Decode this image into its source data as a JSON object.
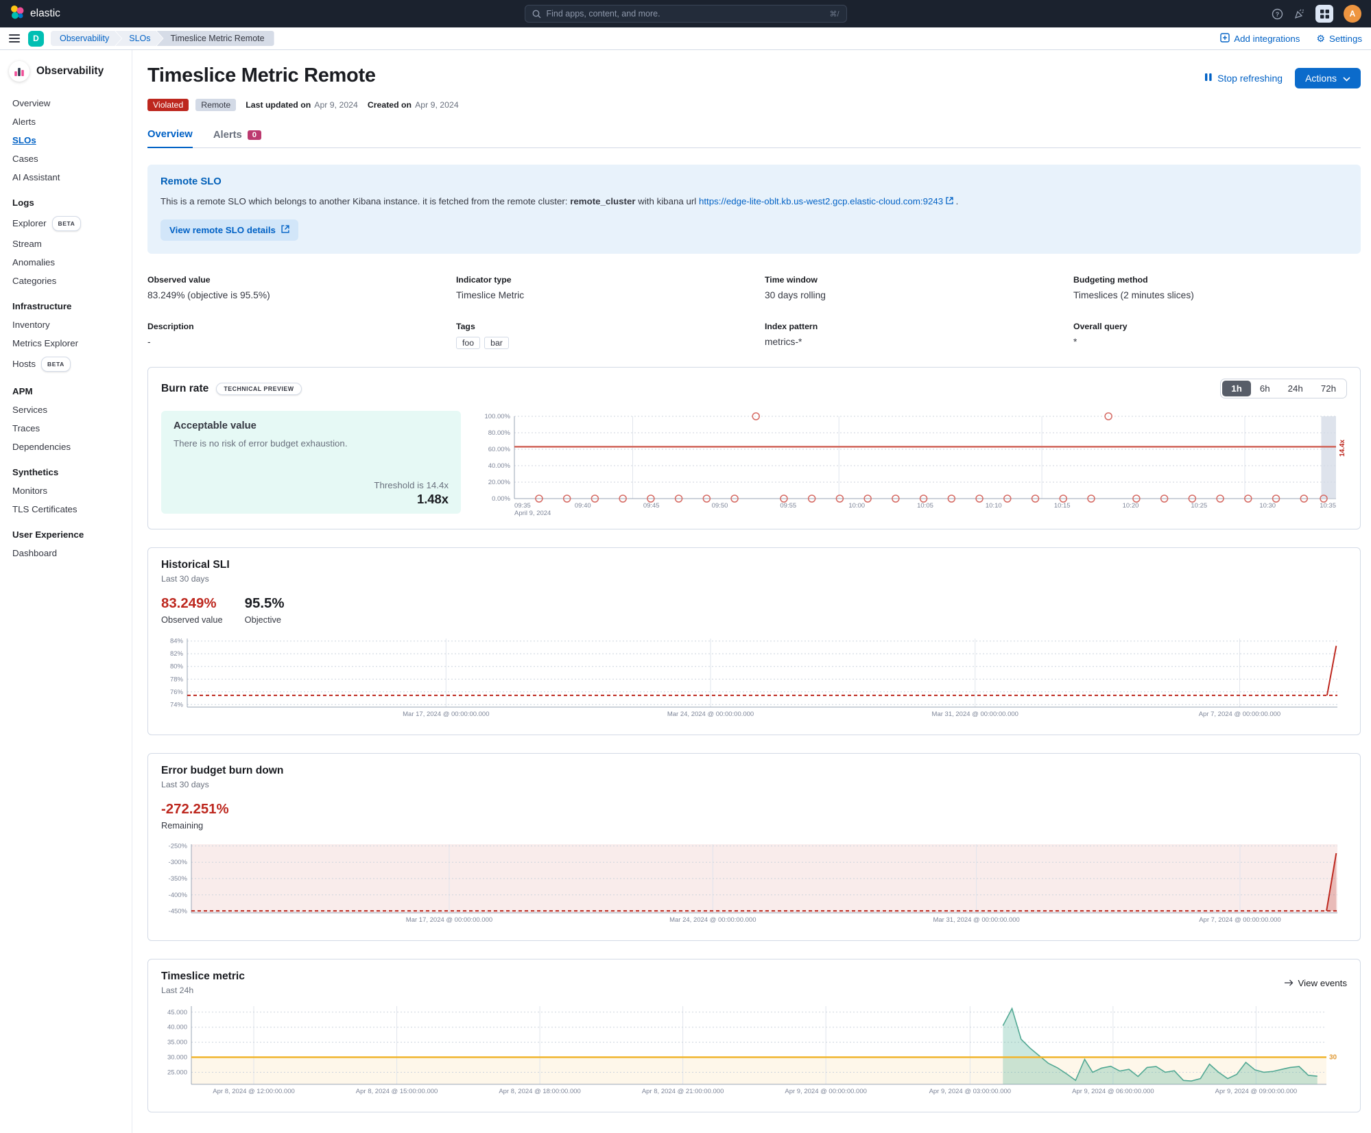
{
  "header": {
    "logo_text": "elastic",
    "search_placeholder": "Find apps, content, and more.",
    "search_shortcut": "⌘/",
    "avatar_initial": "A"
  },
  "nav": {
    "space_initial": "D",
    "breadcrumbs": [
      {
        "label": "Observability",
        "type": "link"
      },
      {
        "label": "SLOs",
        "type": "link"
      },
      {
        "label": "Timeslice Metric Remote",
        "type": "current"
      }
    ],
    "add_integrations": "Add integrations",
    "settings": "Settings"
  },
  "sidebar": {
    "app_title": "Observability",
    "sections": [
      {
        "title": null,
        "items": [
          {
            "label": "Overview"
          },
          {
            "label": "Alerts"
          },
          {
            "label": "SLOs",
            "active": true
          },
          {
            "label": "Cases"
          },
          {
            "label": "AI Assistant"
          }
        ]
      },
      {
        "title": "Logs",
        "items": [
          {
            "label": "Explorer",
            "badge": "BETA"
          },
          {
            "label": "Stream"
          },
          {
            "label": "Anomalies"
          },
          {
            "label": "Categories"
          }
        ]
      },
      {
        "title": "Infrastructure",
        "items": [
          {
            "label": "Inventory"
          },
          {
            "label": "Metrics Explorer"
          },
          {
            "label": "Hosts",
            "badge": "BETA"
          }
        ]
      },
      {
        "title": "APM",
        "items": [
          {
            "label": "Services"
          },
          {
            "label": "Traces"
          },
          {
            "label": "Dependencies"
          }
        ]
      },
      {
        "title": "Synthetics",
        "items": [
          {
            "label": "Monitors"
          },
          {
            "label": "TLS Certificates"
          }
        ]
      },
      {
        "title": "User Experience",
        "items": [
          {
            "label": "Dashboard"
          }
        ]
      }
    ]
  },
  "page": {
    "title": "Timeslice Metric Remote",
    "status_badge": "Violated",
    "remote_badge": "Remote",
    "last_updated_label": "Last updated on",
    "last_updated_value": "Apr 9, 2024",
    "created_label": "Created on",
    "created_value": "Apr 9, 2024",
    "stop_refreshing": "Stop refreshing",
    "actions": "Actions"
  },
  "tabs": [
    {
      "label": "Overview",
      "active": true
    },
    {
      "label": "Alerts",
      "badge": "0"
    }
  ],
  "callout": {
    "title": "Remote SLO",
    "text_before": "This is a remote SLO which belongs to another Kibana instance. it is fetched from the remote cluster:",
    "cluster": "remote_cluster",
    "text_middle": "with kibana url",
    "url": "https://edge-lite-oblt.kb.us-west2.gcp.elastic-cloud.com:9243",
    "text_after": ".",
    "button": "View remote SLO details"
  },
  "definition": {
    "rows": [
      [
        {
          "label": "Observed value",
          "value": "83.249% (objective is 95.5%)"
        },
        {
          "label": "Indicator type",
          "value": "Timeslice Metric"
        },
        {
          "label": "Time window",
          "value": "30 days rolling"
        },
        {
          "label": "Budgeting method",
          "value": "Timeslices (2 minutes slices)"
        }
      ],
      [
        {
          "label": "Description",
          "value": "-"
        },
        {
          "label": "Tags",
          "tags": [
            "foo",
            "bar"
          ]
        },
        {
          "label": "Index pattern",
          "value": "metrics-*"
        },
        {
          "label": "Overall query",
          "value": "*"
        }
      ]
    ]
  },
  "burn_rate": {
    "title": "Burn rate",
    "badge": "TECHNICAL PREVIEW",
    "ranges": [
      "1h",
      "6h",
      "24h",
      "72h"
    ],
    "selected_range": "1h",
    "box_title": "Acceptable value",
    "box_text": "There is no risk of error budget exhaustion.",
    "threshold_label": "Threshold is 14.4x",
    "value": "1.48x"
  },
  "panels": {
    "historical_sli": {
      "title": "Historical SLI",
      "subtitle": "Last 30 days",
      "observed": "83.249%",
      "observed_label": "Observed value",
      "objective": "95.5%",
      "objective_label": "Objective"
    },
    "error_budget": {
      "title": "Error budget burn down",
      "subtitle": "Last 30 days",
      "remaining": "-272.251%",
      "remaining_label": "Remaining"
    },
    "timeslice": {
      "title": "Timeslice metric",
      "subtitle": "Last 24h",
      "view_events": "View events"
    }
  },
  "colors": {
    "header_bg": "#1b222e",
    "primary": "#0b6bcb",
    "link": "#0061c5",
    "danger": "#bd271e",
    "danger_muted": "#d0655a",
    "success_bg": "#e6f9f5",
    "warning": "#f1b52e",
    "warning_text": "#e09b38",
    "green_line": "#51a893",
    "green_fill": "rgba(84,179,153,0.30)",
    "pink_fill": "rgba(189,39,30,0.09)",
    "accent_badge": "#bc3a6f",
    "space_teal": "#00bfb3",
    "avatar_orange": "#ee9540"
  },
  "chart_data": [
    {
      "id": "burn_rate",
      "type": "scatter",
      "title": "Burn rate",
      "ylabel": "",
      "xlabel": "",
      "ylim": [
        0,
        100
      ],
      "y_ticks": [
        {
          "v": 100,
          "label": "100.00%"
        },
        {
          "v": 80,
          "label": "80.00%"
        },
        {
          "v": 60,
          "label": "60.00%"
        },
        {
          "v": 40,
          "label": "40.00%"
        },
        {
          "v": 20,
          "label": "20.00%"
        },
        {
          "v": 0,
          "label": "0.00%"
        }
      ],
      "x_ticks": [
        {
          "f": 0.0,
          "label": "09:35",
          "sub": "April 9, 2024",
          "anchor": "start"
        },
        {
          "f": 0.0833,
          "label": "09:40"
        },
        {
          "f": 0.1667,
          "label": "09:45"
        },
        {
          "f": 0.25,
          "label": "09:50"
        },
        {
          "f": 0.3333,
          "label": "09:55"
        },
        {
          "f": 0.4167,
          "label": "10:00"
        },
        {
          "f": 0.5,
          "label": "10:05"
        },
        {
          "f": 0.5833,
          "label": "10:10"
        },
        {
          "f": 0.6667,
          "label": "10:15"
        },
        {
          "f": 0.75,
          "label": "10:20"
        },
        {
          "f": 0.8333,
          "label": "10:25"
        },
        {
          "f": 0.9167,
          "label": "10:30"
        },
        {
          "f": 1.0,
          "label": "10:35",
          "anchor": "end"
        }
      ],
      "v_gridlines": [
        0.144,
        0.395,
        0.642,
        0.889
      ],
      "threshold": {
        "value": 63,
        "label": "14.4x"
      },
      "current_band": [
        0.982,
        1.0
      ],
      "points": [
        [
          0.03,
          0
        ],
        [
          0.064,
          0
        ],
        [
          0.098,
          0
        ],
        [
          0.132,
          0
        ],
        [
          0.166,
          0
        ],
        [
          0.2,
          0
        ],
        [
          0.234,
          0
        ],
        [
          0.268,
          0
        ],
        [
          0.294,
          100
        ],
        [
          0.328,
          0
        ],
        [
          0.362,
          0
        ],
        [
          0.396,
          0
        ],
        [
          0.43,
          0
        ],
        [
          0.464,
          0
        ],
        [
          0.498,
          0
        ],
        [
          0.532,
          0
        ],
        [
          0.566,
          0
        ],
        [
          0.6,
          0
        ],
        [
          0.634,
          0
        ],
        [
          0.668,
          0
        ],
        [
          0.702,
          0
        ],
        [
          0.723,
          100
        ],
        [
          0.757,
          0
        ],
        [
          0.791,
          0
        ],
        [
          0.825,
          0
        ],
        [
          0.859,
          0
        ],
        [
          0.893,
          0
        ],
        [
          0.927,
          0
        ],
        [
          0.961,
          0
        ],
        [
          0.985,
          0
        ]
      ]
    },
    {
      "id": "historical_sli",
      "type": "line",
      "title": "Historical SLI",
      "ylim": [
        73.6,
        84.4
      ],
      "y_ticks": [
        {
          "v": 84,
          "label": "84%"
        },
        {
          "v": 82,
          "label": "82%"
        },
        {
          "v": 80,
          "label": "80%"
        },
        {
          "v": 78,
          "label": "78%"
        },
        {
          "v": 76,
          "label": "76%"
        },
        {
          "v": 74,
          "label": "74%"
        }
      ],
      "x_ticks": [
        {
          "f": 0.225,
          "label": "Mar 17, 2024 @ 00:00:00.000"
        },
        {
          "f": 0.455,
          "label": "Mar 24, 2024 @ 00:00:00.000"
        },
        {
          "f": 0.685,
          "label": "Mar 31, 2024 @ 00:00:00.000"
        },
        {
          "f": 0.915,
          "label": "Apr 7, 2024 @ 00:00:00.000"
        }
      ],
      "v_gridlines": [
        0.225,
        0.455,
        0.685,
        0.915
      ],
      "dashed_value": 75.45,
      "spike": [
        [
          0.991,
          75.45
        ],
        [
          0.999,
          83.25
        ]
      ]
    },
    {
      "id": "error_budget",
      "type": "area",
      "title": "Error budget burn down",
      "ylim": [
        -455,
        -245
      ],
      "y_ticks": [
        {
          "v": -250,
          "label": "-250%"
        },
        {
          "v": -300,
          "label": "-300%"
        },
        {
          "v": -350,
          "label": "-350%"
        },
        {
          "v": -400,
          "label": "-400%"
        },
        {
          "v": -450,
          "label": "-450%"
        }
      ],
      "x_ticks": [
        {
          "f": 0.225,
          "label": "Mar 17, 2024 @ 00:00:00.000"
        },
        {
          "f": 0.455,
          "label": "Mar 24, 2024 @ 00:00:00.000"
        },
        {
          "f": 0.685,
          "label": "Mar 31, 2024 @ 00:00:00.000"
        },
        {
          "f": 0.915,
          "label": "Apr 7, 2024 @ 00:00:00.000"
        }
      ],
      "v_gridlines": [
        0.225,
        0.455,
        0.685,
        0.915
      ],
      "fill_full": true,
      "dashed_value": -449,
      "spike": [
        [
          0.9905,
          -449
        ],
        [
          0.999,
          -272.3
        ]
      ],
      "spike_fill": true
    },
    {
      "id": "timeslice_metric",
      "type": "area",
      "title": "Timeslice metric",
      "ylim": [
        21,
        47
      ],
      "y_ticks": [
        {
          "v": 45,
          "label": "45.000"
        },
        {
          "v": 40,
          "label": "40.000"
        },
        {
          "v": 35,
          "label": "35.000"
        },
        {
          "v": 30,
          "label": "30.000"
        },
        {
          "v": 25,
          "label": "25.000"
        }
      ],
      "x_ticks": [
        {
          "f": 0.055,
          "label": "Apr 8, 2024 @ 12:00:00.000"
        },
        {
          "f": 0.181,
          "label": "Apr 8, 2024 @ 15:00:00.000"
        },
        {
          "f": 0.307,
          "label": "Apr 8, 2024 @ 18:00:00.000"
        },
        {
          "f": 0.433,
          "label": "Apr 8, 2024 @ 21:00:00.000"
        },
        {
          "f": 0.559,
          "label": "Apr 9, 2024 @ 00:00:00.000"
        },
        {
          "f": 0.686,
          "label": "Apr 9, 2024 @ 03:00:00.000"
        },
        {
          "f": 0.812,
          "label": "Apr 9, 2024 @ 06:00:00.000"
        },
        {
          "f": 0.938,
          "label": "Apr 9, 2024 @ 09:00:00.000"
        }
      ],
      "v_gridlines": [
        0.055,
        0.181,
        0.307,
        0.433,
        0.559,
        0.686,
        0.812,
        0.938
      ],
      "threshold": {
        "value": 30,
        "label": "30"
      },
      "band_below_threshold": true,
      "series": [
        [
          0.715,
          40.5
        ],
        [
          0.723,
          46.2
        ],
        [
          0.731,
          36
        ],
        [
          0.739,
          33
        ],
        [
          0.747,
          30.5
        ],
        [
          0.755,
          28
        ],
        [
          0.763,
          26.5
        ],
        [
          0.771,
          24.5
        ],
        [
          0.779,
          22.3
        ],
        [
          0.787,
          29.3
        ],
        [
          0.794,
          25
        ],
        [
          0.802,
          26.4
        ],
        [
          0.81,
          27
        ],
        [
          0.818,
          25.4
        ],
        [
          0.826,
          26
        ],
        [
          0.834,
          23.6
        ],
        [
          0.842,
          26.6
        ],
        [
          0.85,
          26.9
        ],
        [
          0.858,
          25
        ],
        [
          0.866,
          25.5
        ],
        [
          0.874,
          22.3
        ],
        [
          0.881,
          22.1
        ],
        [
          0.889,
          22.9
        ],
        [
          0.897,
          27.7
        ],
        [
          0.905,
          25
        ],
        [
          0.913,
          22.9
        ],
        [
          0.921,
          24.3
        ],
        [
          0.929,
          28.3
        ],
        [
          0.937,
          25.8
        ],
        [
          0.945,
          25
        ],
        [
          0.953,
          25.3
        ],
        [
          0.961,
          26
        ],
        [
          0.968,
          26.6
        ],
        [
          0.976,
          26.9
        ],
        [
          0.984,
          24
        ],
        [
          0.992,
          23.7
        ]
      ]
    }
  ]
}
